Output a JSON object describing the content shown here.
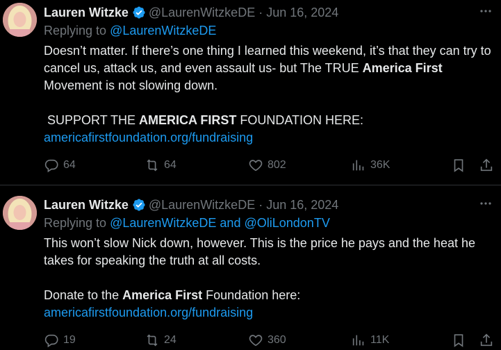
{
  "colors": {
    "background": "#000000",
    "text": "#e7e9ea",
    "muted": "#71767b",
    "link": "#1d9bf0",
    "divider": "#2f3336"
  },
  "tweets": [
    {
      "author_name": "Lauren Witzke",
      "handle": "@LaurenWitzkeDE",
      "separator": "·",
      "date": "Jun 16, 2024",
      "reply_prefix": "Replying to",
      "reply_targets": "@LaurenWitzkeDE",
      "paragraph1_a": "Doesn’t matter. If there’s one thing I learned this weekend, it’s that they can try to cancel us, attack us, and even assault us- but The TRUE ",
      "paragraph1_bold": "America First",
      "paragraph1_b": " Movement is not slowing down.",
      "paragraph2_a": " SUPPORT THE ",
      "paragraph2_bold": "AMERICA FIRST",
      "paragraph2_b": " FOUNDATION HERE:",
      "link": "americafirstfoundation.org/fundraising",
      "replies": "64",
      "reposts": "64",
      "likes": "802",
      "views": "36K"
    },
    {
      "author_name": "Lauren Witzke",
      "handle": "@LaurenWitzkeDE",
      "separator": "·",
      "date": "Jun 16, 2024",
      "reply_prefix": "Replying to",
      "reply_target1": "@LaurenWitzkeDE",
      "reply_and": "and",
      "reply_target2": "@OliLondonTV",
      "paragraph1": "This won’t slow Nick down, however. This is the price he pays and the heat he takes for speaking the truth at all costs.",
      "paragraph2_a": "Donate to the ",
      "paragraph2_bold": "America First",
      "paragraph2_b": " Foundation here:",
      "link": "americafirstfoundation.org/fundraising",
      "replies": "19",
      "reposts": "24",
      "likes": "360",
      "views": "11K"
    }
  ],
  "icons": {
    "verified": "verified-badge-icon",
    "more": "more-dots-icon",
    "reply": "reply-bubble-icon",
    "repost": "repost-arrows-icon",
    "like": "heart-icon",
    "views": "bar-chart-icon",
    "bookmark": "bookmark-icon",
    "share": "share-icon"
  }
}
